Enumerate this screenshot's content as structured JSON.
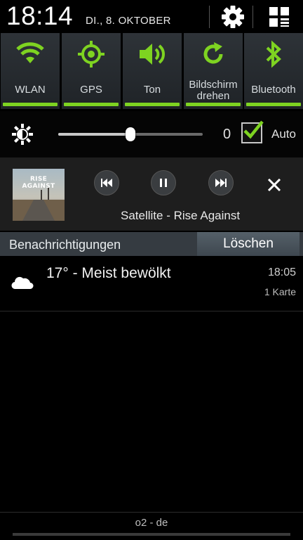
{
  "status": {
    "time": "18:14",
    "date": "DI., 8. OKTOBER",
    "settings_icon": "gear-icon",
    "grid_icon": "quick-settings-grid-icon"
  },
  "toggles": [
    {
      "label": "WLAN",
      "icon": "wifi-icon",
      "active": true
    },
    {
      "label": "GPS",
      "icon": "gps-icon",
      "active": true
    },
    {
      "label": "Ton",
      "icon": "speaker-icon",
      "active": true
    },
    {
      "label": "Bildschirm drehen",
      "label_line1": "Bildschirm",
      "label_line2": "drehen",
      "icon": "rotate-icon",
      "active": true
    },
    {
      "label": "Bluetooth",
      "icon": "bluetooth-icon",
      "active": true
    }
  ],
  "brightness": {
    "value": "0",
    "level": 0.5,
    "auto_checked": true,
    "auto_label": "Auto"
  },
  "media": {
    "album_text": "RISE AGAINST",
    "track": "Satellite - Rise Against",
    "buttons": [
      "previous-icon",
      "pause-icon",
      "next-icon"
    ]
  },
  "notifications": {
    "title": "Benachrichtigungen",
    "clear_label": "Löschen",
    "items": [
      {
        "icon": "cloud-icon",
        "text": "17° - Meist bewölkt",
        "time": "18:05",
        "sub": "1 Karte"
      }
    ]
  },
  "footer": {
    "carrier": "o2 - de"
  },
  "colors": {
    "accent": "#7ed321",
    "tile": "#2a2f34",
    "header_bar": "#353b41",
    "player_bg": "#1e1e1e"
  }
}
